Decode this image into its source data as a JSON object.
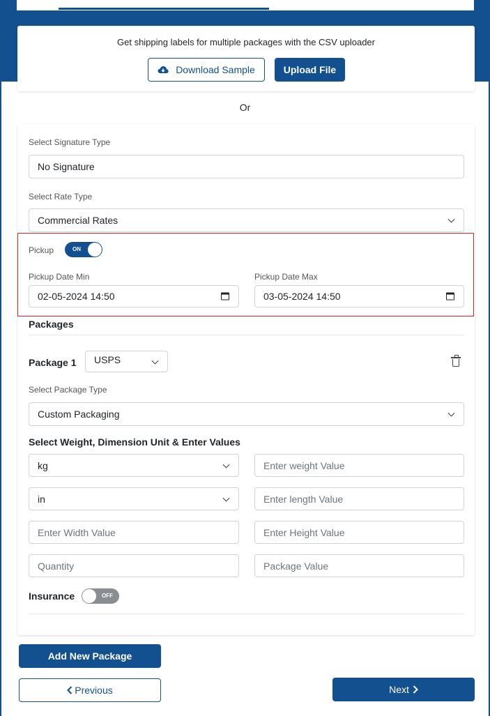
{
  "csv": {
    "prompt": "Get shipping labels for multiple packages with the CSV uploader",
    "download_label": "Download Sample",
    "upload_label": "Upload File"
  },
  "or_label": "Or",
  "signature": {
    "label": "Select Signature Type",
    "value": "No Signature"
  },
  "rate": {
    "label": "Select Rate Type",
    "value": "Commercial Rates"
  },
  "pickup": {
    "label": "Pickup",
    "toggle_text": "ON",
    "enabled": true,
    "min_label": "Pickup Date Min",
    "min_value": "02-05-2024 14:50",
    "max_label": "Pickup Date Max",
    "max_value": "03-05-2024 14:50"
  },
  "packages": {
    "heading": "Packages",
    "items": [
      {
        "title": "Package 1",
        "carrier": "USPS",
        "type_label": "Select Package Type",
        "type_value": "Custom Packaging",
        "units_heading": "Select Weight, Dimension Unit & Enter Values",
        "weight_unit": "kg",
        "weight_placeholder": "Enter weight Value",
        "dimension_unit": "in",
        "length_placeholder": "Enter length Value",
        "width_placeholder": "Enter Width Value",
        "height_placeholder": "Enter Height Value",
        "quantity_placeholder": "Quantity",
        "value_placeholder": "Package Value",
        "insurance_label": "Insurance",
        "insurance_toggle_text": "OFF",
        "insurance_enabled": false
      }
    ]
  },
  "actions": {
    "add_package": "Add New Package",
    "previous": "Previous",
    "next": "Next"
  },
  "colors": {
    "primary": "#12508f",
    "highlight": "#e2231a"
  },
  "icons": {
    "download": "cloud-download-icon",
    "calendar": "calendar-icon",
    "chevron": "chevron-down-icon",
    "delete": "trash-icon"
  }
}
